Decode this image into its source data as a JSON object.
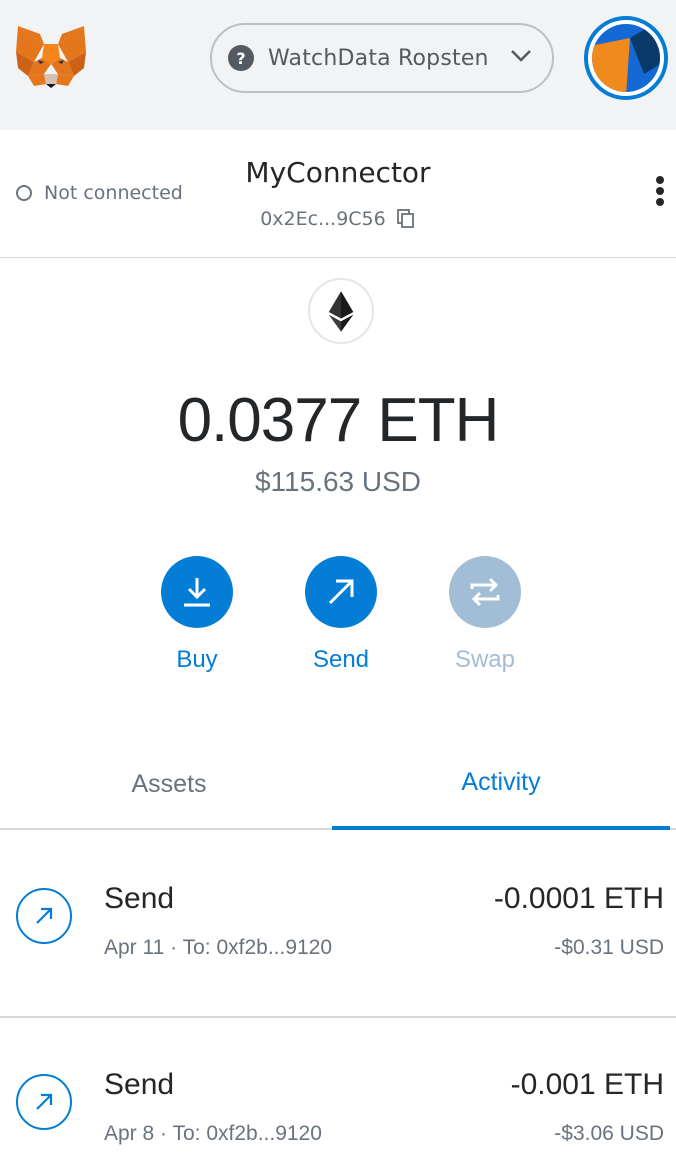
{
  "header": {
    "network_label": "WatchData Ropsten",
    "network_help_glyph": "?"
  },
  "account": {
    "connection_status": "Not connected",
    "name": "MyConnector",
    "address_short": "0x2Ec...9C56"
  },
  "balance": {
    "primary": "0.0377 ETH",
    "fiat": "$115.63 USD"
  },
  "actions": {
    "buy_label": "Buy",
    "send_label": "Send",
    "swap_label": "Swap"
  },
  "tabs": {
    "assets_label": "Assets",
    "activity_label": "Activity"
  },
  "activity": [
    {
      "title": "Send",
      "subtitle": "Apr 11 · To: 0xf2b...9120",
      "amount": "-0.0001 ETH",
      "fiat": "-$0.31 USD"
    },
    {
      "title": "Send",
      "subtitle": "Apr 8 · To: 0xf2b...9120",
      "amount": "-0.001 ETH",
      "fiat": "-$3.06 USD"
    }
  ],
  "colors": {
    "accent": "#037dd6",
    "accent_disabled": "#a2bdd6",
    "muted_text": "#6a737d",
    "header_bg": "#f2f3f4",
    "fox_orange": "#e2761b"
  },
  "icons": {
    "logo": "metamask-fox-icon",
    "network_help": "question-icon",
    "network_dropdown": "chevron-down-icon",
    "avatar": "account-identicon",
    "copy": "copy-icon",
    "menu": "kebab-menu-icon",
    "eth": "ethereum-icon",
    "buy": "download-icon",
    "send": "arrow-up-right-icon",
    "swap": "swap-arrows-icon"
  }
}
